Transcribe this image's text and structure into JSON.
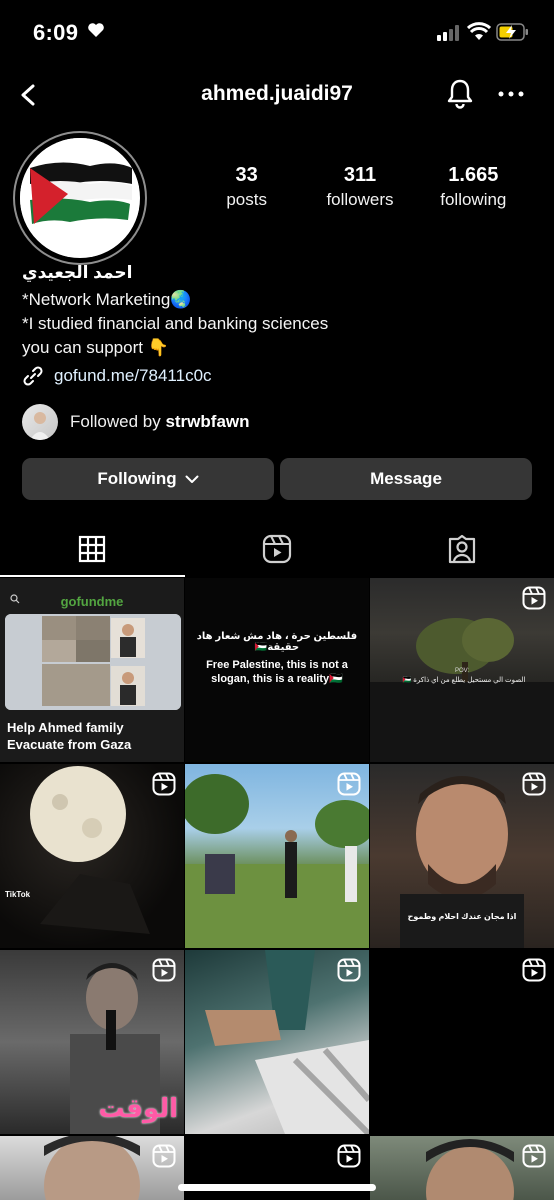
{
  "status_bar": {
    "time": "6:09"
  },
  "header": {
    "username": "ahmed.juaidi97"
  },
  "profile": {
    "stats": [
      {
        "value": "33",
        "label": "posts"
      },
      {
        "value": "311",
        "label": "followers"
      },
      {
        "value": "1.665",
        "label": "following"
      }
    ],
    "display_name": "احمد الجعيدي",
    "bio_lines": [
      "*Network Marketing🌏",
      "*I studied financial and banking sciences",
      "you can support 👇"
    ],
    "link": "gofund.me/78411c0c",
    "followed_by_prefix": "Followed by ",
    "followed_by_user": "strwbfawn"
  },
  "actions": {
    "following_label": "Following",
    "message_label": "Message"
  },
  "posts": {
    "gofundme_brand": "gofundme",
    "gofundme_title": "Help Ahmed family Evacuate from Gaza",
    "post2_arabic": "فلسطين حرة ، هاد مش شعار هاد حقيقة🇵🇸",
    "post2_english": "Free Palestine, this is not a slogan, this is a reality🇵🇸",
    "post3_pov": "POV:",
    "post3_caption": "الصوت الي مستحيل يطلع من اي ذاكرة 🇵🇸",
    "post4_watermark": "TikTok",
    "post6_caption": "اذا مجان عندك احلام وطموح",
    "post7_text": "الوقت"
  }
}
